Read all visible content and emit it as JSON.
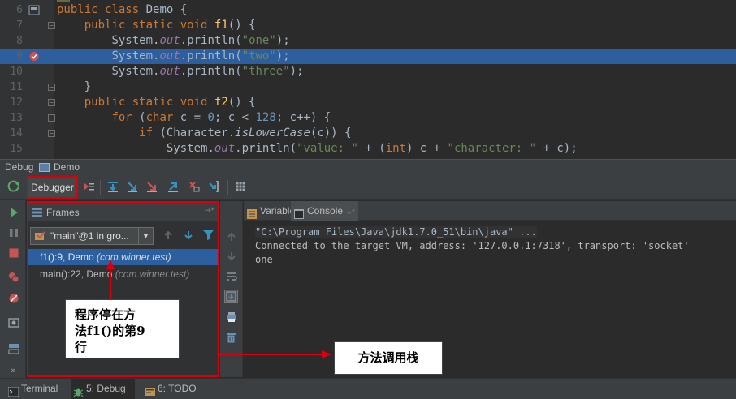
{
  "editor": {
    "lines": [
      {
        "num": "6",
        "code": "public class Demo {"
      },
      {
        "num": "7",
        "code": "public static void f1() {"
      },
      {
        "num": "8",
        "code": "System.out.println(\"one\");"
      },
      {
        "num": "9",
        "code": "System.out.println(\"two\");"
      },
      {
        "num": "10",
        "code": "System.out.println(\"three\");"
      },
      {
        "num": "11",
        "code": "}"
      },
      {
        "num": "12",
        "code": "public static void f2() {"
      },
      {
        "num": "13",
        "code": "for (char c = 0; c < 128; c++) {"
      },
      {
        "num": "14",
        "code": "if (Character.isLowerCase(c)) {"
      },
      {
        "num": "15",
        "code": "System.out.println(\"value: \" + (int) c + \"character: \" + c);"
      }
    ],
    "tokens": {
      "kw_public": "public",
      "kw_class": "class",
      "kw_static": "static",
      "kw_void": "void",
      "kw_for": "for",
      "kw_char": "char",
      "kw_if": "if",
      "kw_int": "int",
      "cls_demo": "Demo",
      "fn_f1": "f1",
      "fn_f2": "f2",
      "system": "System",
      "out": "out",
      "println": "println",
      "str_one": "\"one\"",
      "str_two": "\"two\"",
      "str_three": "\"three\"",
      "str_value": "\"value: \"",
      "str_character": "\"character: \"",
      "num_0": "0",
      "num_128": "128",
      "character": "Character",
      "is_lower_case": "isLowerCase"
    },
    "highlighted_line": "9",
    "breakpoint_line": "9"
  },
  "debug_title": {
    "label": "Debug",
    "config": "Demo"
  },
  "toolbar": {
    "debugger_tab": "Debugger"
  },
  "frames": {
    "title": "Frames",
    "thread": "\"main\"@1 in gro...",
    "items": [
      {
        "method": "f1():9, Demo",
        "package": "(com.winner.test)",
        "selected": true
      },
      {
        "method": "main():22, Demo",
        "package": "(com.winner.test)",
        "selected": false
      }
    ]
  },
  "right_tabs": {
    "variables": "Variables",
    "variables_pin": "→*",
    "console": "Console",
    "console_pin": "→*"
  },
  "frames_pin": "→*",
  "console": {
    "lines": [
      "\"C:\\Program Files\\Java\\jdk1.7.0_51\\bin\\java\" ...",
      "Connected to the target VM, address: '127.0.0.1:7318', transport: 'socket'",
      "one"
    ]
  },
  "bottom_tabs": [
    {
      "label": "Terminal"
    },
    {
      "label": "5: Debug"
    },
    {
      "label": "6: TODO"
    }
  ],
  "annotations": {
    "stop_note": [
      "程序停在方",
      "法f1()的第9",
      "行"
    ],
    "stack_note": "方法调用栈"
  },
  "colors": {
    "background": "#2b2b2b",
    "selection": "#2d5f9e",
    "keyword": "#cc7832",
    "string": "#6a8759",
    "number": "#6897bb",
    "annotation_red": "#d9000d"
  },
  "icons": {
    "breakpoint": "breakpoint-icon",
    "bookmark": "bookmark-icon",
    "rerun": "rerun-icon",
    "resume": "resume-icon",
    "pause": "pause-icon",
    "stop": "stop-icon"
  }
}
